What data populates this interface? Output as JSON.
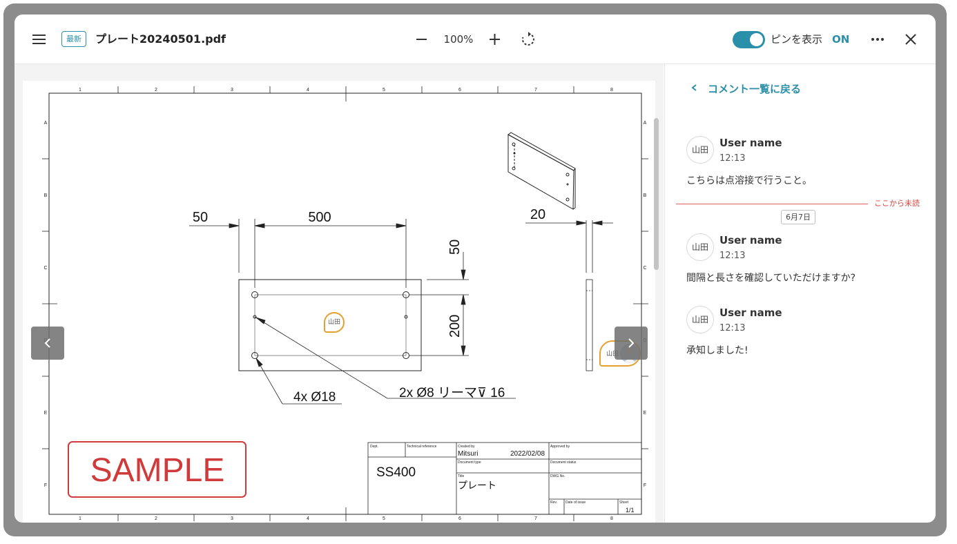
{
  "header": {
    "latest_badge": "最新",
    "filename": "プレート20240501.pdf",
    "zoom_level": "100%",
    "pin_toggle_label": "ピンを表示",
    "pin_toggle_state": "ON",
    "icons": [
      "menu-icon",
      "minus-icon",
      "plus-icon",
      "rotate-icon",
      "more-icon",
      "close-icon"
    ],
    "accent_color": "#2a8fa8"
  },
  "drawing": {
    "col_labels": [
      "1",
      "2",
      "3",
      "4",
      "5",
      "6",
      "7",
      "8"
    ],
    "row_labels": [
      "A",
      "B",
      "C",
      "D",
      "E",
      "F"
    ],
    "dim_50": "50",
    "dim_500": "500",
    "dim_50_v": "50",
    "dim_200": "200",
    "dim_20": "20",
    "callout_holes": "4x Ø18",
    "callout_ream": "2x Ø8 リーマ⊽ 16",
    "stamp": "SAMPLE",
    "title_block": {
      "dept_label": "Dept.",
      "tech_ref_label": "Technical reference",
      "created_by_label": "Created by",
      "created_by": "Mitsuri",
      "created_date": "2022/02/08",
      "approved_by_label": "Approved by",
      "material": "SS400",
      "doc_type_label": "Document type",
      "doc_status_label": "Document status",
      "title_label": "Title",
      "title": "プレート",
      "dwg_no_label": "DWG No.",
      "rev_label": "Rev.",
      "date_of_issue_label": "Date of issue",
      "sheet_label": "Sheet",
      "sheet": "1/1"
    },
    "pins": {
      "pin1_label": "山田",
      "pin2_label": "山田"
    }
  },
  "sidebar": {
    "back_label": "コメント一覧に戻る",
    "unread_label": "ここから未読",
    "date_chip": "6月7日",
    "comments": [
      {
        "avatar": "山田",
        "user": "User name",
        "time": "12:13",
        "text": "こちらは点溶接で行うこと。"
      },
      {
        "avatar": "山田",
        "user": "User name",
        "time": "12:13",
        "text": "間隔と長さを確認していただけますか?"
      },
      {
        "avatar": "山田",
        "user": "User name",
        "time": "12:13",
        "text": "承知しました!"
      }
    ]
  }
}
